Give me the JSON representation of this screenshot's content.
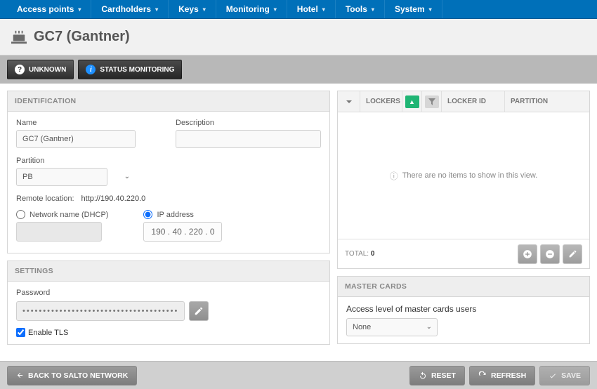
{
  "nav": {
    "items": [
      {
        "label": "Access points"
      },
      {
        "label": "Cardholders"
      },
      {
        "label": "Keys"
      },
      {
        "label": "Monitoring"
      },
      {
        "label": "Hotel"
      },
      {
        "label": "Tools"
      },
      {
        "label": "System"
      }
    ]
  },
  "page_title": "GC7 (Gantner)",
  "status_buttons": {
    "unknown": "UNKNOWN",
    "monitor": "STATUS MONITORING"
  },
  "identification": {
    "header": "IDENTIFICATION",
    "name_label": "Name",
    "name_value": "GC7 (Gantner)",
    "desc_label": "Description",
    "desc_value": "",
    "partition_label": "Partition",
    "partition_value": "PB",
    "remote_label": "Remote location:",
    "remote_url": "http://190.40.220.0",
    "radio_dhcp": "Network name (DHCP)",
    "radio_ip": "IP address",
    "ip_value": "190 . 40 . 220 . 0"
  },
  "settings": {
    "header": "SETTINGS",
    "password_label": "Password",
    "password_mask": "•••••••••••••••••••••••••••••••••••••••",
    "enable_tls": "Enable TLS"
  },
  "lockers": {
    "col_lockers": "LOCKERS",
    "col_locker_id": "LOCKER ID",
    "col_partition": "PARTITION",
    "empty_text": "There are no items to show in this view.",
    "total_label": "TOTAL:",
    "total_value": "0"
  },
  "master_cards": {
    "header": "MASTER CARDS",
    "access_label": "Access level of master cards users",
    "access_value": "None"
  },
  "footer": {
    "back": "BACK TO SALTO NETWORK",
    "reset": "RESET",
    "refresh": "REFRESH",
    "save": "SAVE"
  }
}
